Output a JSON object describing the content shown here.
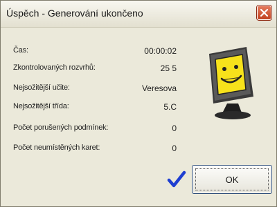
{
  "window": {
    "title": "Úspěch - Generování ukončeno",
    "close_label": "X"
  },
  "stats": [
    {
      "label": "Čas:",
      "value": "00:00:02"
    },
    {
      "label": "Zkontrolovaných rozvrhů:",
      "value": "25 5"
    },
    {
      "label": "Nejsožitější učite:",
      "value": "Veresova"
    },
    {
      "label": "Nejsožitější třída:",
      "value": "5.C"
    },
    {
      "label": "Počet porušených podmínek:",
      "value": "0"
    },
    {
      "label": "Počet neumístěných karet:",
      "value": "0"
    }
  ],
  "icons": {
    "mascot": "computer-mascot-icon",
    "success": "checkmark-icon",
    "close": "close-icon"
  },
  "buttons": {
    "ok_label": "OK"
  },
  "colors": {
    "background": "#ebe9da",
    "close_button": "#c1411f",
    "checkmark": "#1f3fd1",
    "mascot_screen": "#f7e21b"
  }
}
